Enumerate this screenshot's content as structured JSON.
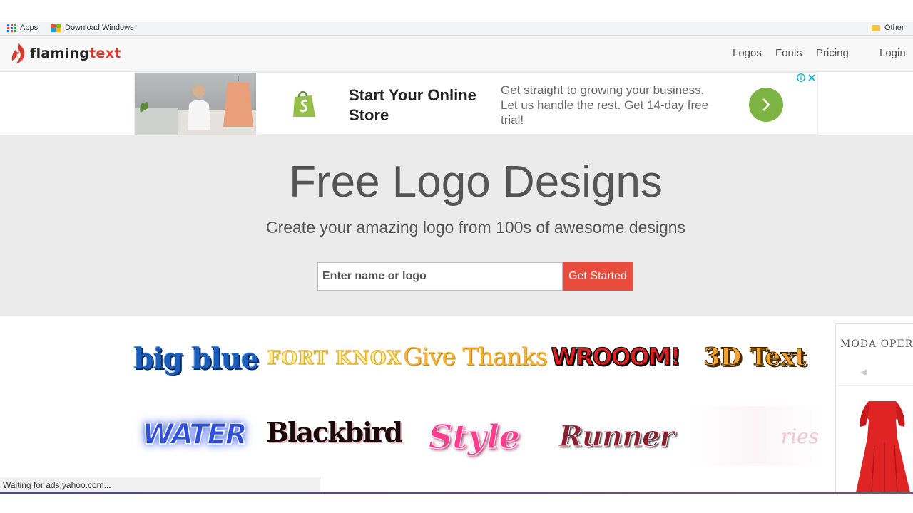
{
  "browser": {
    "bookmarks": [
      {
        "label": "Apps"
      },
      {
        "label": "Download Windows"
      },
      {
        "label": "Other"
      }
    ],
    "status_text": "Waiting for ads.yahoo.com..."
  },
  "site": {
    "brand_first": "flaming",
    "brand_second": "text",
    "nav": [
      {
        "label": "Logos"
      },
      {
        "label": "Fonts"
      },
      {
        "label": "Pricing"
      },
      {
        "label": "Login"
      }
    ]
  },
  "ad": {
    "title": "Start Your Online Store",
    "body": "Get straight to growing your business. Let us handle the rest. Get 14-day free trial!",
    "accent_color": "#7cb342"
  },
  "hero": {
    "title": "Free Logo Designs",
    "subtitle": "Create your amazing logo from 100s of awesome designs",
    "input_placeholder": "Enter name or logo",
    "button_label": "Get Started",
    "button_color": "#e74c3c"
  },
  "logos": [
    {
      "text": "big blue"
    },
    {
      "text": "FORT KNOX"
    },
    {
      "text": "Give Thanks"
    },
    {
      "text": "WROOOM!"
    },
    {
      "text": "3D Text"
    },
    {
      "text": "WATER"
    },
    {
      "text": "Blackbird"
    },
    {
      "text": "Style"
    },
    {
      "text": "Runner"
    },
    {
      "text": "ries"
    }
  ],
  "side_ad": {
    "brand": "MODA OPER"
  }
}
